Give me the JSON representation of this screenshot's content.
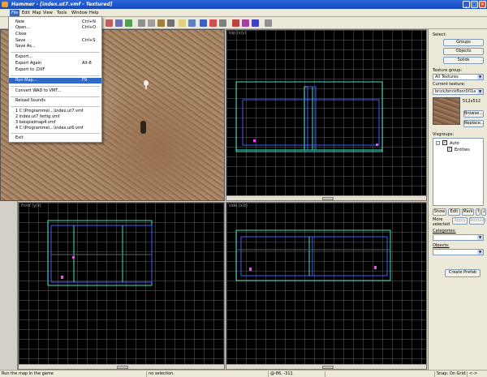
{
  "titlebar": {
    "title": "Hammer - [index.ut7.vmf - Textured]",
    "minimize": "_",
    "maximize": "□",
    "close": "✕"
  },
  "menubar": {
    "items": [
      "File",
      "Edit",
      "Map",
      "View",
      "Tools",
      "Window",
      "Help"
    ]
  },
  "file_menu": {
    "items": [
      {
        "label": "New",
        "shortcut": "Ctrl+N"
      },
      {
        "label": "Open...",
        "shortcut": "Ctrl+O"
      },
      {
        "label": "Close",
        "shortcut": ""
      },
      {
        "label": "Save",
        "shortcut": "Ctrl+S"
      },
      {
        "label": "Save As...",
        "shortcut": ""
      },
      {
        "label": "Export...",
        "shortcut": ""
      },
      {
        "label": "Export Again",
        "shortcut": "Alt-B"
      },
      {
        "label": "Export to .DXF",
        "shortcut": ""
      },
      {
        "label": "Run Map...",
        "shortcut": "F9"
      },
      {
        "label": "Convert WAD to VMT...",
        "shortcut": ""
      },
      {
        "label": "Reload Sounds",
        "shortcut": ""
      },
      {
        "label": "1 C:\\Programme\\...\\index.ut7.vmf",
        "shortcut": ""
      },
      {
        "label": "2 index.ut7 fertig.vmf",
        "shortcut": ""
      },
      {
        "label": "3 beispielmap4.vmf",
        "shortcut": ""
      },
      {
        "label": "4 C:\\Programme\\...\\index.ut6.vmf",
        "shortcut": ""
      },
      {
        "label": "Exit",
        "shortcut": ""
      }
    ]
  },
  "viewports": {
    "top": "top (x/y)",
    "front": "front (y/z)",
    "side": "side (x/z)"
  },
  "right_panel": {
    "select_label": "Select:",
    "groups": "Groups",
    "objects": "Objects",
    "solids": "Solids",
    "texture_group_label": "Texture group:",
    "texture_group_value": "All Textures",
    "current_texture_label": "Current texture:",
    "current_texture_value": "brick/brickfloor001a",
    "texture_size": "512x512",
    "browse": "Browse...",
    "replace": "Replace...",
    "visgroups_label": "Visgroups:",
    "vis_auto": "Auto",
    "vis_entities": "Entities",
    "show": "Show",
    "edit": "Edit",
    "mark": "Mark",
    "more_selected": "More selected",
    "apply": "Apply",
    "remove": "Remove",
    "categories_label": "Categories:",
    "objects_label": "Objects:",
    "create_prefab": "Create Prefab"
  },
  "statusbar": {
    "help": "Run the map in the game",
    "selection": "no selection.",
    "coords": "@-86, -311",
    "snap": "Snap: On Grid: 64",
    "extra": "<->"
  },
  "colors": {
    "accent": "#316ac5",
    "brush_cyan": "#40e0c8",
    "brush_blue": "#4060ff",
    "entity_magenta": "#ff40ff"
  }
}
